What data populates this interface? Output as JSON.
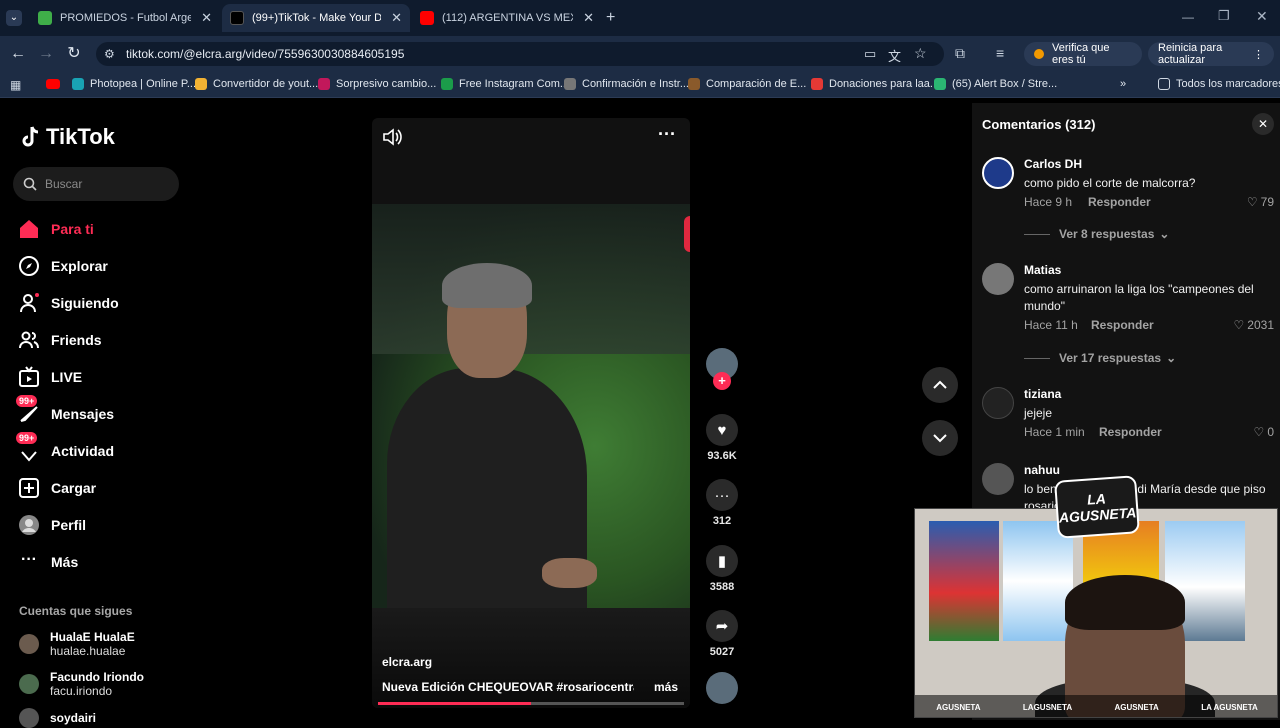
{
  "browser": {
    "tabs": [
      {
        "title": "PROMIEDOS - Futbol Argentino",
        "color": "#3fae49"
      },
      {
        "title": "(99+)TikTok - Make Your Day",
        "color": "#000000"
      },
      {
        "title": "(112) ARGENTINA VS MEXICO |",
        "color": "#ff0000"
      }
    ],
    "url": "tiktok.com/@elcra.arg/video/7559630030884605195",
    "verify_label": "Verifica que eres tú",
    "update_label": "Reinicia para actualizar",
    "bookmarks": [
      {
        "label": "Photopea | Online P...",
        "color": "#19a3b4"
      },
      {
        "label": "Convertidor de yout...",
        "color": "#f2b233"
      },
      {
        "label": "Sorpresivo cambio...",
        "color": "#c2185b"
      },
      {
        "label": "Free Instagram Com...",
        "color": "#1b9c4a"
      },
      {
        "label": "Confirmación e Instr...",
        "color": "#777777"
      },
      {
        "label": "Comparación de E...",
        "color": "#8a5a2b"
      },
      {
        "label": "Donaciones para laa...",
        "color": "#e53935"
      },
      {
        "label": "(65) Alert Box / Stre...",
        "color": "#2bb673"
      }
    ],
    "bookmarks_overflow": "»",
    "all_bookmarks": "Todos los marcadores"
  },
  "tiktok": {
    "logo": "TikTok",
    "search_placeholder": "Buscar",
    "menu": [
      {
        "label": "Para ti",
        "icon": "home-icon",
        "active": true
      },
      {
        "label": "Explorar",
        "icon": "compass-icon"
      },
      {
        "label": "Siguiendo",
        "icon": "following-icon"
      },
      {
        "label": "Friends",
        "icon": "friends-icon"
      },
      {
        "label": "LIVE",
        "icon": "live-icon"
      },
      {
        "label": "Mensajes",
        "icon": "messages-icon",
        "badge": "99+"
      },
      {
        "label": "Actividad",
        "icon": "activity-icon",
        "badge": "99+"
      },
      {
        "label": "Cargar",
        "icon": "upload-icon"
      },
      {
        "label": "Perfil",
        "icon": "profile-icon"
      },
      {
        "label": "Más",
        "icon": "more-icon"
      }
    ],
    "following_header": "Cuentas que sigues",
    "following": [
      {
        "name": "HualaE HualaE",
        "handle": "hualae.hualae"
      },
      {
        "name": "Facundo Iriondo",
        "handle": "facu.iriondo"
      },
      {
        "name": "soydairi",
        "handle": ""
      }
    ]
  },
  "video": {
    "author": "elcra.arg",
    "caption": "Nueva Edición CHEQUEOVAR #rosariocentral ...",
    "more": "más",
    "progress": 0.5,
    "likes": "93.6K",
    "comments": "312",
    "saves": "3588",
    "shares": "5027"
  },
  "comments": {
    "title": "Comentarios (312)",
    "reply_label": "Responder",
    "items": [
      {
        "name": "Carlos DH",
        "text": "como pido el corte de malcorra?",
        "time": "Hace 9 h",
        "likes": "79",
        "replies": "Ver 8 respuestas",
        "avatar_color": "#1e3a8a"
      },
      {
        "name": "Matias",
        "text": "como arruinaron la liga los \"campeones del mundo\"",
        "time": "Hace 11 h",
        "likes": "2031",
        "replies": "Ver 17 respuestas",
        "avatar_color": "#777777"
      },
      {
        "name": "tiziana",
        "text": "jejeje",
        "time": "Hace 1 min",
        "likes": "0",
        "avatar_color": "#222222"
      },
      {
        "name": "nahuu",
        "text": "lo beneficia que está di María desde que piso rosario",
        "avatar_color": "#555555"
      }
    ]
  },
  "webcam": {
    "logo_text": "LA AGUSNETA",
    "socials": [
      "AGUSNETA",
      "LAGUSNETA",
      "AGUSNETA",
      "LA AGUSNETA"
    ]
  }
}
